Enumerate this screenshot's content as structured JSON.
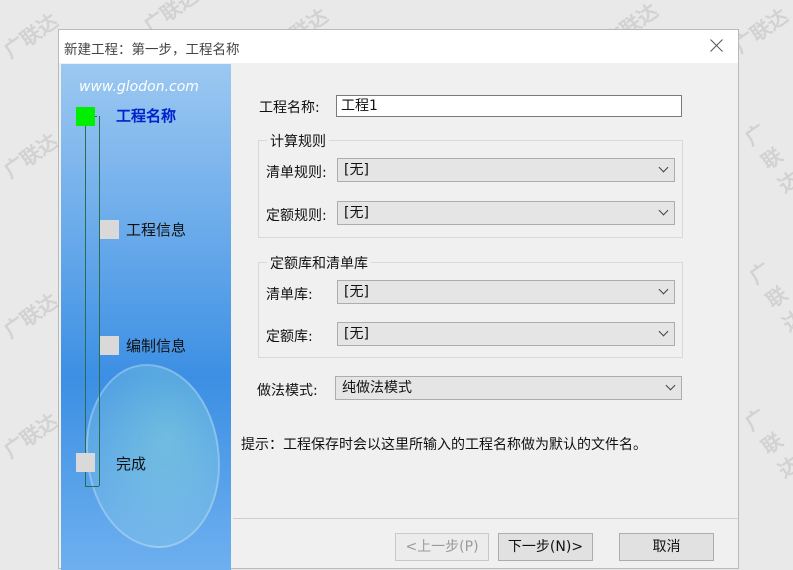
{
  "watermark_text": "广联达",
  "dialog": {
    "title": "新建工程：第一步，工程名称"
  },
  "sidebar": {
    "url": "www.glodon.com",
    "steps": [
      {
        "label": "工程名称",
        "active": true
      },
      {
        "label": "工程信息",
        "active": false
      },
      {
        "label": "编制信息",
        "active": false
      },
      {
        "label": "完成",
        "active": false
      }
    ]
  },
  "form": {
    "project_name": {
      "label": "工程名称:",
      "value": "工程1"
    },
    "calc_rules": {
      "title": "计算规则",
      "bill_rule": {
        "label": "清单规则:",
        "value": "[无]"
      },
      "quota_rule": {
        "label": "定额规则:",
        "value": "[无]"
      }
    },
    "libraries": {
      "title": "定额库和清单库",
      "bill_lib": {
        "label": "清单库:",
        "value": "[无]"
      },
      "quota_lib": {
        "label": "定额库:",
        "value": "[无]"
      }
    },
    "method_mode": {
      "label": "做法模式:",
      "value": "纯做法模式"
    },
    "tip": "提示：工程保存时会以这里所输入的工程名称做为默认的文件名。"
  },
  "buttons": {
    "prev": "<上一步(P)",
    "next": "下一步(N)>",
    "cancel": "取消"
  }
}
